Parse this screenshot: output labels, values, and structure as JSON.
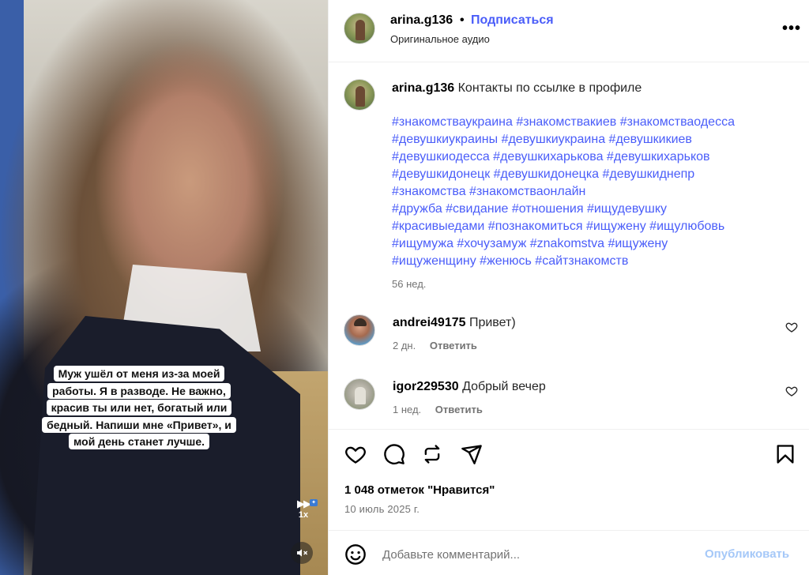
{
  "video": {
    "caption": "Муж ушёл от меня из-за моей работы. Я в разводе. Не важно, красив ты или нет, богатый или бедный. Напиши мне «Привет», и мой день станет лучше.",
    "speed_label": "1x",
    "speed_icon": "fast-forward-icon",
    "mute_icon": "muted-speaker-icon"
  },
  "header": {
    "username": "arina.g136",
    "separator": "•",
    "follow_label": "Подписаться",
    "audio_label": "Оригинальное аудио",
    "more_label": "•••"
  },
  "post": {
    "username": "arina.g136",
    "caption_text": "Контакты по ссылке в профиле",
    "hashtag_lines": [
      "#знакомстваукраина #знакомствакиев #знакомстваодесса",
      "#девушкиукраины #девушкиукраина #девушкикиев",
      "#девушкиодесса #девушкихарькова #девушкихарьков",
      "#девушкидонецк #девушкидонецка #девушкиднепр",
      "#знакомства #знакомстваонлайн",
      "#дружба #свидание #отношения #ищудевушку",
      "#красивыедами #познакомиться #ищужену #ищулюбовь",
      "#ищумужа #хочузамуж #znakomstva #ищужену",
      "#ищуженщину #женюсь #сайтзнакомств"
    ],
    "time_ago": "56 нед."
  },
  "comments": [
    {
      "username": "andrei49175",
      "text": "Привет)",
      "time": "2 дн.",
      "reply_label": "Ответить"
    },
    {
      "username": "igor229530",
      "text": "Добрый вечер",
      "time": "1 нед.",
      "reply_label": "Ответить"
    }
  ],
  "actions": {
    "icons": [
      "heart-icon",
      "comment-icon",
      "repost-icon",
      "share-icon",
      "bookmark-icon"
    ],
    "likes_text": "1 048 отметок \"Нравится\"",
    "date_text": "10 июль 2025 г."
  },
  "add_comment": {
    "placeholder": "Добавьте комментарий...",
    "post_label": "Опубликовать"
  },
  "colors": {
    "link_blue": "#4a5df9",
    "muted_gray": "#737373",
    "post_disabled": "#a5c8f8",
    "divider": "#efefef"
  }
}
